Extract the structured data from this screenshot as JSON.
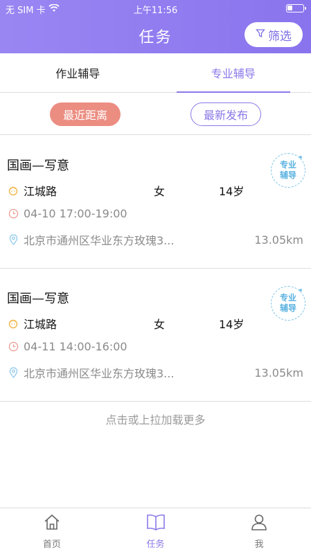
{
  "status": {
    "carrier": "无 SIM 卡",
    "time": "上午11:56"
  },
  "header": {
    "title": "任务",
    "filter_label": "筛选"
  },
  "tabs": [
    {
      "label": "作业辅导",
      "active": false
    },
    {
      "label": "专业辅导",
      "active": true
    }
  ],
  "sort": {
    "nearest_label": "最近距离",
    "newest_label": "最新发布"
  },
  "tasks": [
    {
      "name": "国画—写意",
      "badge_line1": "专业",
      "badge_line2": "辅导",
      "location": "江城路",
      "gender": "女",
      "age": "14岁",
      "time": "04-10 17:00-19:00",
      "address": "北京市通州区华业东方玫瑰3...",
      "distance": "13.05km"
    },
    {
      "name": "国画—写意",
      "badge_line1": "专业",
      "badge_line2": "辅导",
      "location": "江城路",
      "gender": "女",
      "age": "14岁",
      "time": "04-11 14:00-16:00",
      "address": "北京市通州区华业东方玫瑰3...",
      "distance": "13.05km"
    }
  ],
  "load_more": "点击或上拉加载更多",
  "bottom_nav": [
    {
      "label": "首页"
    },
    {
      "label": "任务"
    },
    {
      "label": "我"
    }
  ],
  "colors": {
    "accent": "#8a78e8",
    "pill_active": "#ec8d82",
    "badge": "#59b1e0"
  }
}
